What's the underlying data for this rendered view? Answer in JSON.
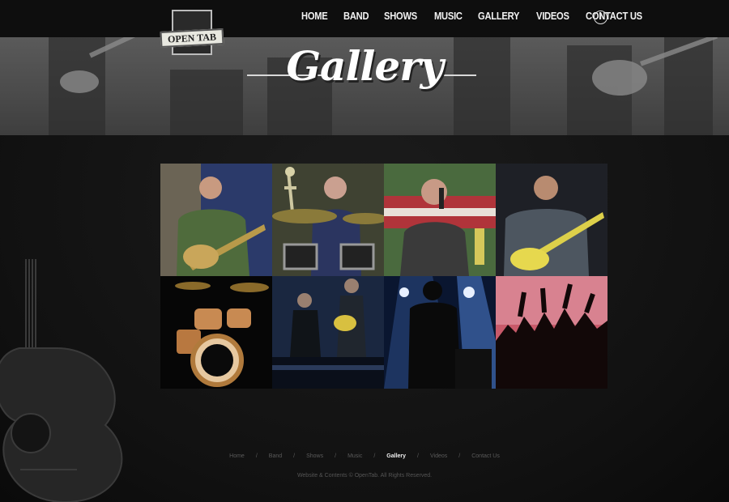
{
  "nav": {
    "items": [
      "HOME",
      "BAND",
      "SHOWS",
      "MUSIC",
      "GALLERY",
      "VIDEOS",
      "CONTACT US"
    ],
    "facebook_glyph": "f"
  },
  "logo": {
    "text": "OPEN TAB"
  },
  "hero": {
    "title": "Gallery"
  },
  "gallery": {
    "photos": [
      "bassist-photo",
      "drummer-photo",
      "singer-photo",
      "guitarist-photo",
      "drum-kit-photo",
      "band-stage-photo",
      "stage-lights-photo",
      "crowd-photo"
    ]
  },
  "footer": {
    "links": [
      "Home",
      "Band",
      "Shows",
      "Music",
      "Gallery",
      "Videos",
      "Contact Us"
    ],
    "active": "Gallery",
    "copyright": "Website & Contents © OpenTab. All Rights Reserved."
  },
  "colors": {
    "background": "#141414",
    "nav_text": "#f2f2f2",
    "footer_text": "#5a5a5a"
  }
}
